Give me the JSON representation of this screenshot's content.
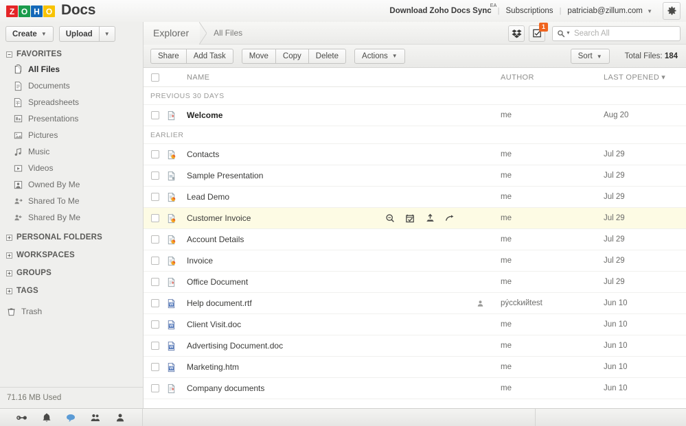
{
  "header": {
    "logo_letters": [
      "Z",
      "O",
      "H",
      "O"
    ],
    "product": "Docs",
    "links": [
      {
        "label": "Download Zoho Docs Sync",
        "sup": "EA",
        "bold": true
      },
      {
        "label": "Subscriptions",
        "bold": false
      },
      {
        "label": "patriciab@zillum.com",
        "bold": false,
        "caret": true
      }
    ],
    "separator": "|",
    "gear": "gear-icon"
  },
  "sidebar": {
    "create_label": "Create",
    "upload_label": "Upload",
    "sections": [
      {
        "label": "FAVORITES",
        "state": "expanded",
        "toggle": "−"
      },
      {
        "label": "PERSONAL FOLDERS",
        "state": "collapsed",
        "toggle": "+"
      },
      {
        "label": "WORKSPACES",
        "state": "collapsed",
        "toggle": "+"
      },
      {
        "label": "GROUPS",
        "state": "collapsed",
        "toggle": "+"
      },
      {
        "label": "TAGS",
        "state": "collapsed",
        "toggle": "+"
      }
    ],
    "favorites": [
      {
        "label": "All Files",
        "icon": "all-files-icon",
        "selected": true
      },
      {
        "label": "Documents",
        "icon": "document-icon",
        "selected": false
      },
      {
        "label": "Spreadsheets",
        "icon": "spreadsheet-icon",
        "selected": false
      },
      {
        "label": "Presentations",
        "icon": "presentation-icon",
        "selected": false
      },
      {
        "label": "Pictures",
        "icon": "picture-icon",
        "selected": false
      },
      {
        "label": "Music",
        "icon": "music-icon",
        "selected": false
      },
      {
        "label": "Videos",
        "icon": "video-icon",
        "selected": false
      },
      {
        "label": "Owned By Me",
        "icon": "owned-by-me-icon",
        "selected": false
      },
      {
        "label": "Shared To Me",
        "icon": "shared-to-me-icon",
        "selected": false
      },
      {
        "label": "Shared By Me",
        "icon": "shared-by-me-icon",
        "selected": false
      }
    ],
    "trash_label": "Trash",
    "storage_used": "71.16 MB Used"
  },
  "breadcrumb": {
    "root": "Explorer",
    "current": "All Files",
    "dropbox_icon": "dropbox-icon",
    "tasks_icon": "tasks-icon",
    "tasks_badge": "1"
  },
  "search": {
    "placeholder": "Search All",
    "icon": "search-icon"
  },
  "toolbar": {
    "group1": [
      "Share",
      "Add Task"
    ],
    "group2": [
      "Move",
      "Copy",
      "Delete"
    ],
    "actions_label": "Actions",
    "sort_label": "Sort",
    "total_files_label": "Total Files:",
    "total_files_count": "184"
  },
  "table": {
    "columns": {
      "name": "NAME",
      "author": "AUTHOR",
      "last_opened": "LAST OPENED"
    },
    "sort_indicator": "▾",
    "groups": [
      {
        "label": "PREVIOUS 30 DAYS",
        "rows": [
          {
            "name": "Welcome",
            "icon": "document-file-icon",
            "author": "me",
            "date": "Aug 20",
            "bold": true,
            "shared": false,
            "hover": false
          }
        ]
      },
      {
        "label": "EARLIER",
        "rows": [
          {
            "name": "Contacts",
            "icon": "spreadsheet-file-icon",
            "author": "me",
            "date": "Jul 29",
            "bold": false,
            "shared": false,
            "hover": false
          },
          {
            "name": "Sample Presentation",
            "icon": "presentation-file-icon",
            "author": "me",
            "date": "Jul 29",
            "bold": false,
            "shared": false,
            "hover": false
          },
          {
            "name": "Lead Demo",
            "icon": "spreadsheet-file-icon",
            "author": "me",
            "date": "Jul 29",
            "bold": false,
            "shared": false,
            "hover": false
          },
          {
            "name": "Customer Invoice",
            "icon": "spreadsheet-file-icon",
            "author": "me",
            "date": "Jul 29",
            "bold": false,
            "shared": false,
            "hover": true
          },
          {
            "name": "Account Details",
            "icon": "spreadsheet-file-icon",
            "author": "me",
            "date": "Jul 29",
            "bold": false,
            "shared": false,
            "hover": false
          },
          {
            "name": "Invoice",
            "icon": "spreadsheet-file-icon",
            "author": "me",
            "date": "Jul 29",
            "bold": false,
            "shared": false,
            "hover": false
          },
          {
            "name": "Office Document",
            "icon": "document-file-icon",
            "author": "me",
            "date": "Jul 29",
            "bold": false,
            "shared": false,
            "hover": false
          },
          {
            "name": "Help document.rtf",
            "icon": "word-file-icon",
            "author": "pýcckийtest",
            "date": "Jun 10",
            "bold": false,
            "shared": true,
            "hover": false
          },
          {
            "name": "Client Visit.doc",
            "icon": "word-file-icon",
            "author": "me",
            "date": "Jun 10",
            "bold": false,
            "shared": false,
            "hover": false
          },
          {
            "name": "Advertising Document.doc",
            "icon": "word-file-icon",
            "author": "me",
            "date": "Jun 10",
            "bold": false,
            "shared": false,
            "hover": false
          },
          {
            "name": "Marketing.htm",
            "icon": "word-file-icon",
            "author": "me",
            "date": "Jun 10",
            "bold": false,
            "shared": false,
            "hover": false
          },
          {
            "name": "Company documents",
            "icon": "document-file-icon",
            "author": "me",
            "date": "Jun 10",
            "bold": false,
            "shared": false,
            "hover": false
          }
        ]
      }
    ],
    "hover_actions": [
      "preview-icon",
      "add-task-icon",
      "share-icon",
      "edit-icon"
    ]
  },
  "bottombar": {
    "icons": [
      "link-icon",
      "bell-icon",
      "chat-icon",
      "contacts-icon",
      "person-icon"
    ]
  },
  "colors": {
    "brand_red": "#e42527",
    "brand_green": "#1a9b4c",
    "brand_blue": "#1368b8",
    "brand_yellow": "#f8c300",
    "badge_orange": "#f0641e",
    "row_hover": "#fdfbe4"
  }
}
